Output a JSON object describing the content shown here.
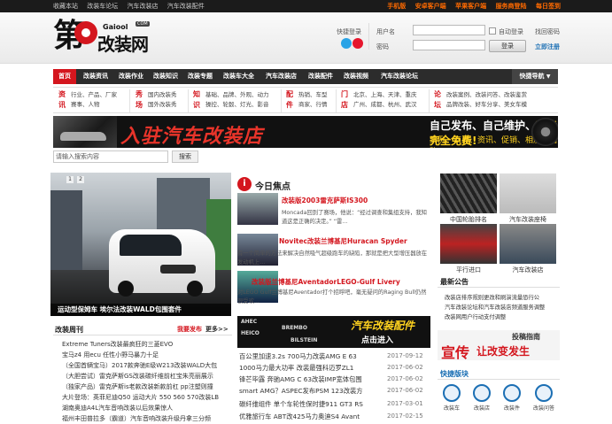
{
  "topbar": {
    "links": [
      "收藏本站",
      "改装车论坛",
      "汽车改装店",
      "汽车改装配件"
    ],
    "apps": [
      "手机版",
      "安卓客户端",
      "苹果客户端",
      "服务商登陆",
      "每日签到"
    ]
  },
  "logo": {
    "number": "第",
    "name": "改装网",
    "domain": "Gaiool",
    "com": "COM"
  },
  "login": {
    "quick_label": "快捷登录",
    "username_label": "用户名",
    "password_label": "密码",
    "remember_label": "自动登录",
    "login_button": "登录",
    "forgot_label": "找回密码",
    "register_label": "立即注册"
  },
  "nav": {
    "items": [
      "首页",
      "改装资讯",
      "改装作业",
      "改装知识",
      "改装专题",
      "改装车大全",
      "汽车改装店",
      "改装配件",
      "改装视频",
      "汽车改装论坛"
    ],
    "quick_nav": "快捷导航"
  },
  "categories": [
    {
      "title": "资讯",
      "lines": [
        "行业、产品、厂家",
        "赛事、人物"
      ]
    },
    {
      "title": "秀场",
      "lines": [
        "国内改装秀",
        "国外改装秀"
      ]
    },
    {
      "title": "知识",
      "lines": [
        "基础、品牌、外观、动力",
        "操控、轮毂、灯光、影音"
      ]
    },
    {
      "title": "配件",
      "lines": [
        "热销、车型",
        "商家、行情"
      ]
    },
    {
      "title": "门店",
      "lines": [
        "北京、上海、天津、重庆",
        "广州、成都、杭州、武汉"
      ]
    },
    {
      "title": "论坛",
      "lines": [
        "改装案例、改装问答、改装鉴赏",
        "品牌改装、好车分享、美女车模"
      ]
    }
  ],
  "banner": {
    "slogan": "入驻汽车改装店",
    "headline_part1": "自己发布、自己维护、",
    "headline_highlight": "功能完全免费!",
    "tags": "案例、商品、资讯、促销、相册、团购"
  },
  "search": {
    "placeholder": "请输入搜索内容",
    "button": "搜索"
  },
  "slide": {
    "caption": "运动型保姆车 埃尔法改装WALD包围套件",
    "dots": [
      "1",
      "2"
    ]
  },
  "focus": {
    "header": "今日焦点",
    "items": [
      {
        "title": "改装版2003雷克萨斯IS300",
        "desc": "Moncada回到了赛场，他说：“经过调查和集组支持，我知道这是正确的决定。” “雷..."
      },
      {
        "title": "Novitec改装兰博基尼Huracan Spyder",
        "desc": "有一个简单的方法来解决自然吸气超级跑车的缺陷，那就是把大型增压器放在发动机上..."
      },
      {
        "title": "改装版兰博基尼AventadorLEGO-Gulf Livery",
        "desc": "对LEGO Gulf兰博基尼Aventador打个招呼吧，毫无疑问的Raging Bull仍然很受欢..."
      }
    ]
  },
  "thumbs": [
    {
      "label": "中国轮胎排名"
    },
    {
      "label": "汽车改装座椅"
    },
    {
      "label": "平行进口"
    },
    {
      "label": "汽车改装店"
    }
  ],
  "weekly": {
    "title": "改装周刊",
    "apply": "我要发布",
    "more": "更多>>",
    "items": [
      "Extreme Tuners改装最疯狂的三菱EVO",
      "宝马z4 用ecu 任性小野马暴力十足",
      "（全国首辆宝马）2017款奔驰E级W213改装WALD大包",
      "（大胆尝试）雷克萨斯GS改装碳纤维前杠宝朱亮丽展示",
      "（独家产品）雷克萨斯is老款改装新款前杠 pp注塑则撞",
      "大片登场：英菲尼迪Q50 运动大片 550 560 570改装LB",
      "湖南奥迪A4L汽车音响改装以后效果惊人",
      "福州丰田普拉多（霸道）汽车音响改装升级丹拿三分频"
    ]
  },
  "ad_strip": {
    "title": "汽车改装配件",
    "subtitle": "点击进入",
    "brands": [
      "AHEC",
      "BREMBO",
      "HEICO",
      "BILSTEIN"
    ]
  },
  "news": [
    {
      "title": "百公里加速3.2s 700马力改装AMG E 63",
      "date": "2017-09-12"
    },
    {
      "title": "1000马力最大功率 改装最强科迈罗ZL1",
      "date": "2017-06-02"
    },
    {
      "title": "锋芒毕露 奔驰AMG C 63改装IMP宽体包围",
      "date": "2017-06-02"
    },
    {
      "title": "smart AMG？ASPEC发布PSM 123改装方",
      "date": "2017-06-02"
    },
    {
      "title": "碳纤维组件 单个车轮性保时捷911 GT3 RS",
      "date": "2017-03-01"
    },
    {
      "title": "优雅旅行车 ABT改425马力奥迪S4 Avant",
      "date": "2017-02-15"
    }
  ],
  "notice": {
    "title": "最新公告",
    "items": [
      "改装店排序规则更改和刷演流量恐行公",
      "汽车改装论坛和汽车改装店频道服务调整",
      "改装网用户行动支付调整"
    ]
  },
  "promo": {
    "small": "投稿指南",
    "big1": "宣传",
    "big2": "让改变发生"
  },
  "quick": {
    "title": "快捷版块",
    "items": [
      "改装车",
      "改装店",
      "改装件",
      "改装问答"
    ]
  },
  "colors": {
    "brand_red": "#d4161e",
    "nav_bg": "#2c2c2c",
    "accent_orange": "#ff6a00"
  }
}
